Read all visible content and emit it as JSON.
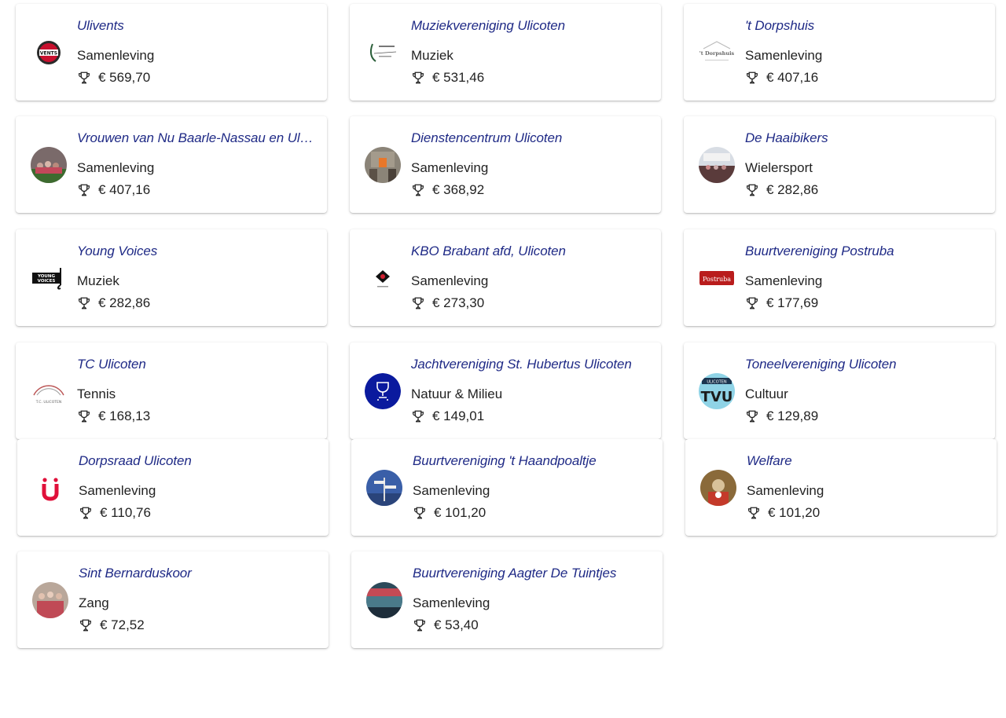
{
  "cards": [
    {
      "name": "Ulivents",
      "category": "Samenleving",
      "amount": "€ 569,70",
      "logo": "ulivents-logo"
    },
    {
      "name": "Muziekvereniging Ulicoten",
      "category": "Muziek",
      "amount": "€ 531,46",
      "logo": "muziekvereniging-logo"
    },
    {
      "name": "'t Dorpshuis",
      "category": "Samenleving",
      "amount": "€ 407,16",
      "logo": "dorpshuis-logo"
    },
    {
      "name": "Vrouwen van Nu Baarle-Nassau en Ulicoten",
      "category": "Samenleving",
      "amount": "€ 407,16",
      "logo": "vrouwen-van-nu-photo"
    },
    {
      "name": "Dienstencentrum Ulicoten",
      "category": "Samenleving",
      "amount": "€ 368,92",
      "logo": "dienstencentrum-photo"
    },
    {
      "name": "De Haaibikers",
      "category": "Wielersport",
      "amount": "€ 282,86",
      "logo": "haaibikers-photo"
    },
    {
      "name": "Young Voices",
      "category": "Muziek",
      "amount": "€ 282,86",
      "logo": "young-voices-logo"
    },
    {
      "name": "KBO Brabant afd, Ulicoten",
      "category": "Samenleving",
      "amount": "€ 273,30",
      "logo": "kbo-logo"
    },
    {
      "name": "Buurtvereniging Postruba",
      "category": "Samenleving",
      "amount": "€ 177,69",
      "logo": "postruba-logo"
    },
    {
      "name": "TC Ulicoten",
      "category": "Tennis",
      "amount": "€ 168,13",
      "logo": "tc-ulicoten-logo"
    },
    {
      "name": "Jachtvereniging St. Hubertus Ulicoten",
      "category": "Natuur & Milieu",
      "amount": "€ 149,01",
      "logo": "trophy-badge-logo"
    },
    {
      "name": "Toneelvereniging Ulicoten",
      "category": "Cultuur",
      "amount": "€ 129,89",
      "logo": "toneelvereniging-logo"
    },
    {
      "name": "Dorpsraad Ulicoten",
      "category": "Samenleving",
      "amount": "€ 110,76",
      "logo": "dorpsraad-logo"
    },
    {
      "name": "Buurtvereniging 't Haandpoaltje",
      "category": "Samenleving",
      "amount": "€ 101,20",
      "logo": "haandpoaltje-photo"
    },
    {
      "name": "Welfare",
      "category": "Samenleving",
      "amount": "€ 101,20",
      "logo": "welfare-photo"
    },
    {
      "name": "Sint Bernarduskoor",
      "category": "Zang",
      "amount": "€ 72,52",
      "logo": "bernarduskoor-photo"
    },
    {
      "name": "Buurtvereniging Aagter De Tuintjes",
      "category": "Samenleving",
      "amount": "€ 53,40",
      "logo": "aagter-de-tuintjes-photo"
    }
  ],
  "colors": {
    "name_text": "#1f2a86",
    "body_text": "#222222",
    "badge_blue": "#0a1a9e",
    "dorpsraad_red": "#e0103a"
  },
  "icons": {
    "amount": "trophy-icon"
  }
}
